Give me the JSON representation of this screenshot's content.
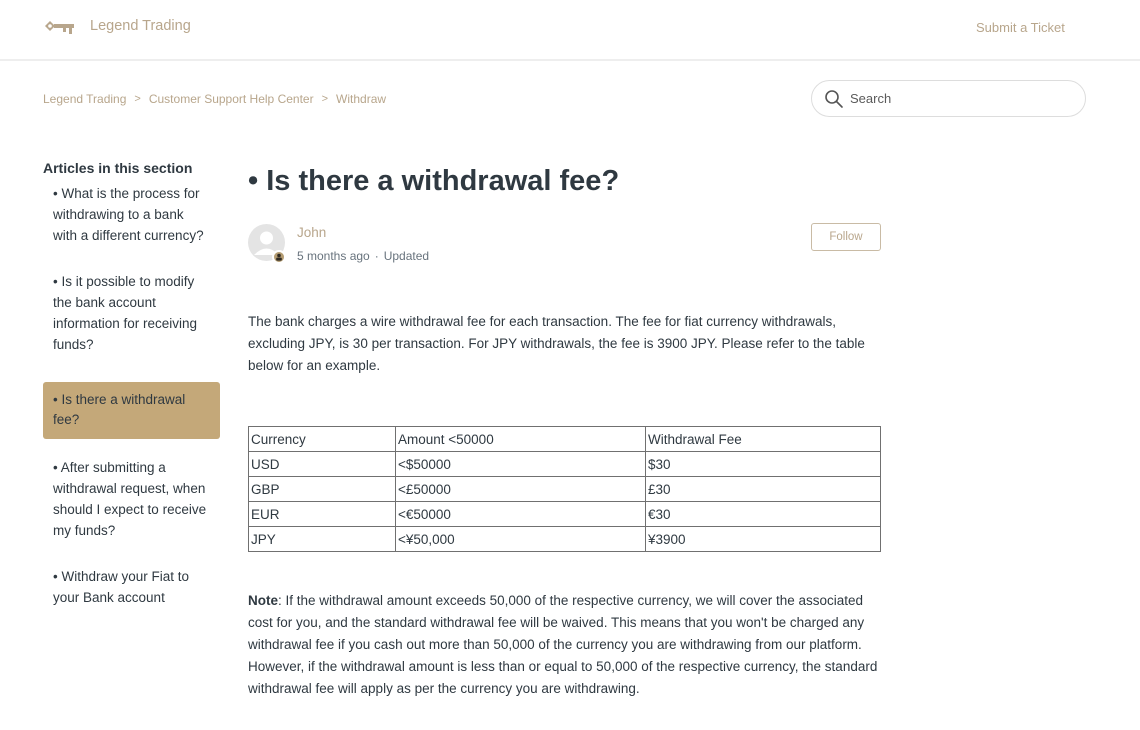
{
  "header": {
    "brand": "Legend Trading",
    "logo_icon": "key-icon",
    "submit_ticket": "Submit a Ticket"
  },
  "breadcrumb": [
    {
      "label": "Legend Trading"
    },
    {
      "label": "Customer Support Help Center"
    },
    {
      "label": "Withdraw"
    }
  ],
  "breadcrumb_separator": ">",
  "search": {
    "placeholder": "Search",
    "value": "",
    "icon": "search-icon"
  },
  "sidebar": {
    "title": "Articles in this section",
    "items": [
      {
        "label": "• What is the process for withdrawing to a bank with a different currency?",
        "active": false
      },
      {
        "label": "• Is it possible to modify the bank account information for receiving funds?",
        "active": false
      },
      {
        "label": "• Is there a withdrawal fee?",
        "active": true
      },
      {
        "label": "• After submitting a withdrawal request, when should I expect to receive my funds?",
        "active": false
      },
      {
        "label": "• Withdraw your Fiat to your Bank account",
        "active": false
      }
    ]
  },
  "article": {
    "title": "• Is there a withdrawal fee?",
    "author": {
      "name": "John",
      "time": "5 months ago",
      "separator": "·",
      "status": "Updated"
    },
    "follow_label": "Follow",
    "intro": "The bank charges a wire withdrawal fee for each transaction. The fee for fiat currency withdrawals, excluding JPY, is 30 per transaction. For JPY withdrawals, the fee is 3900 JPY. Please refer to the table below for an example.",
    "table": {
      "headers": [
        "Currency",
        "Amount <50000",
        "Withdrawal Fee"
      ],
      "rows": [
        [
          "USD",
          "<$50000",
          "$30"
        ],
        [
          "GBP",
          "<£50000",
          "£30"
        ],
        [
          "EUR",
          "<€50000",
          "€30"
        ],
        [
          "JPY",
          "<¥50,000",
          "¥3900"
        ]
      ]
    },
    "note_label": "Note",
    "note_text": ": If the withdrawal amount exceeds 50,000 of the respective currency, we will cover the associated cost for you, and the standard withdrawal fee will be waived. This means that you won't be charged any withdrawal fee if you cash out more than 50,000 of the currency you are withdrawing from our platform. However, if the withdrawal amount is less than or equal to 50,000 of the respective currency, the standard withdrawal fee will apply as per the currency you are withdrawing."
  },
  "colors": {
    "accent": "#b8a68c",
    "active_item_bg": "#c4a879",
    "text": "#2f3941"
  }
}
